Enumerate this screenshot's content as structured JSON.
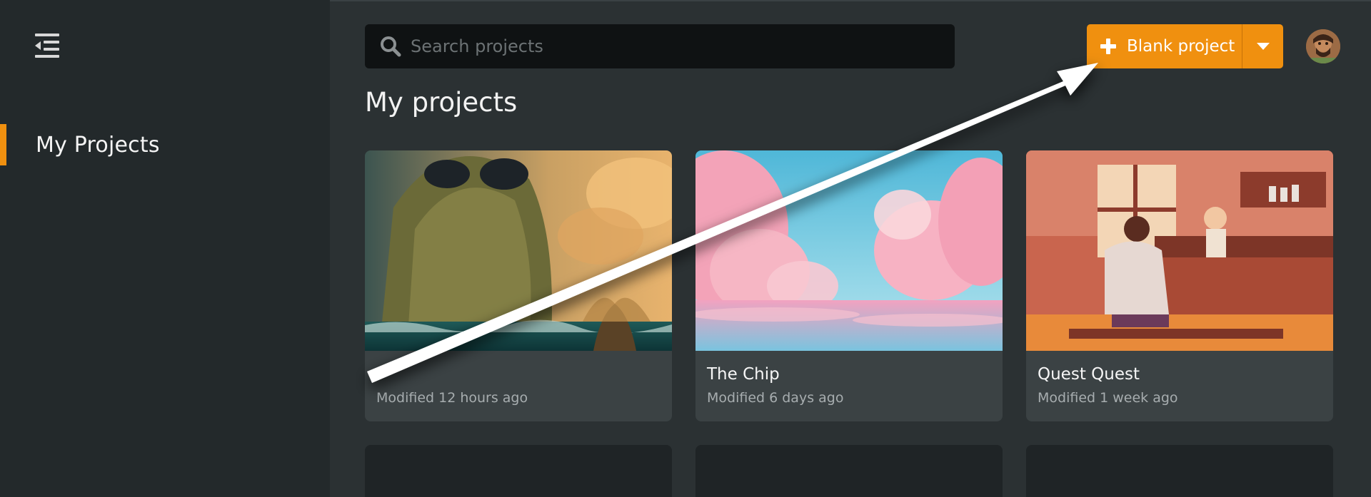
{
  "sidebar": {
    "nav_items": [
      {
        "label": "My Projects",
        "active": true
      }
    ],
    "collapse_icon": "menu-collapse-icon",
    "accent_color": "#f0900f"
  },
  "search": {
    "placeholder": "Search projects",
    "value": "",
    "icon": "search-icon"
  },
  "actions": {
    "blank_project_label": "Blank project",
    "plus_icon": "plus-icon",
    "dropdown_icon": "caret-down-icon",
    "button_color": "#f0900f"
  },
  "user": {
    "avatar_icon": "user-avatar"
  },
  "main": {
    "title": "My projects",
    "projects": [
      {
        "name": "",
        "modified": "Modified 12 hours ago",
        "thumbnail": "sea-monster-illustration"
      },
      {
        "name": "The Chip",
        "modified": "Modified 6 days ago",
        "thumbnail": "pink-clouds-illustration"
      },
      {
        "name": "Quest Quest",
        "modified": "Modified 1 week ago",
        "thumbnail": "tavern-illustration"
      }
    ]
  },
  "annotation": {
    "arrow_icon": "annotation-arrow",
    "color": "#ffffff"
  }
}
